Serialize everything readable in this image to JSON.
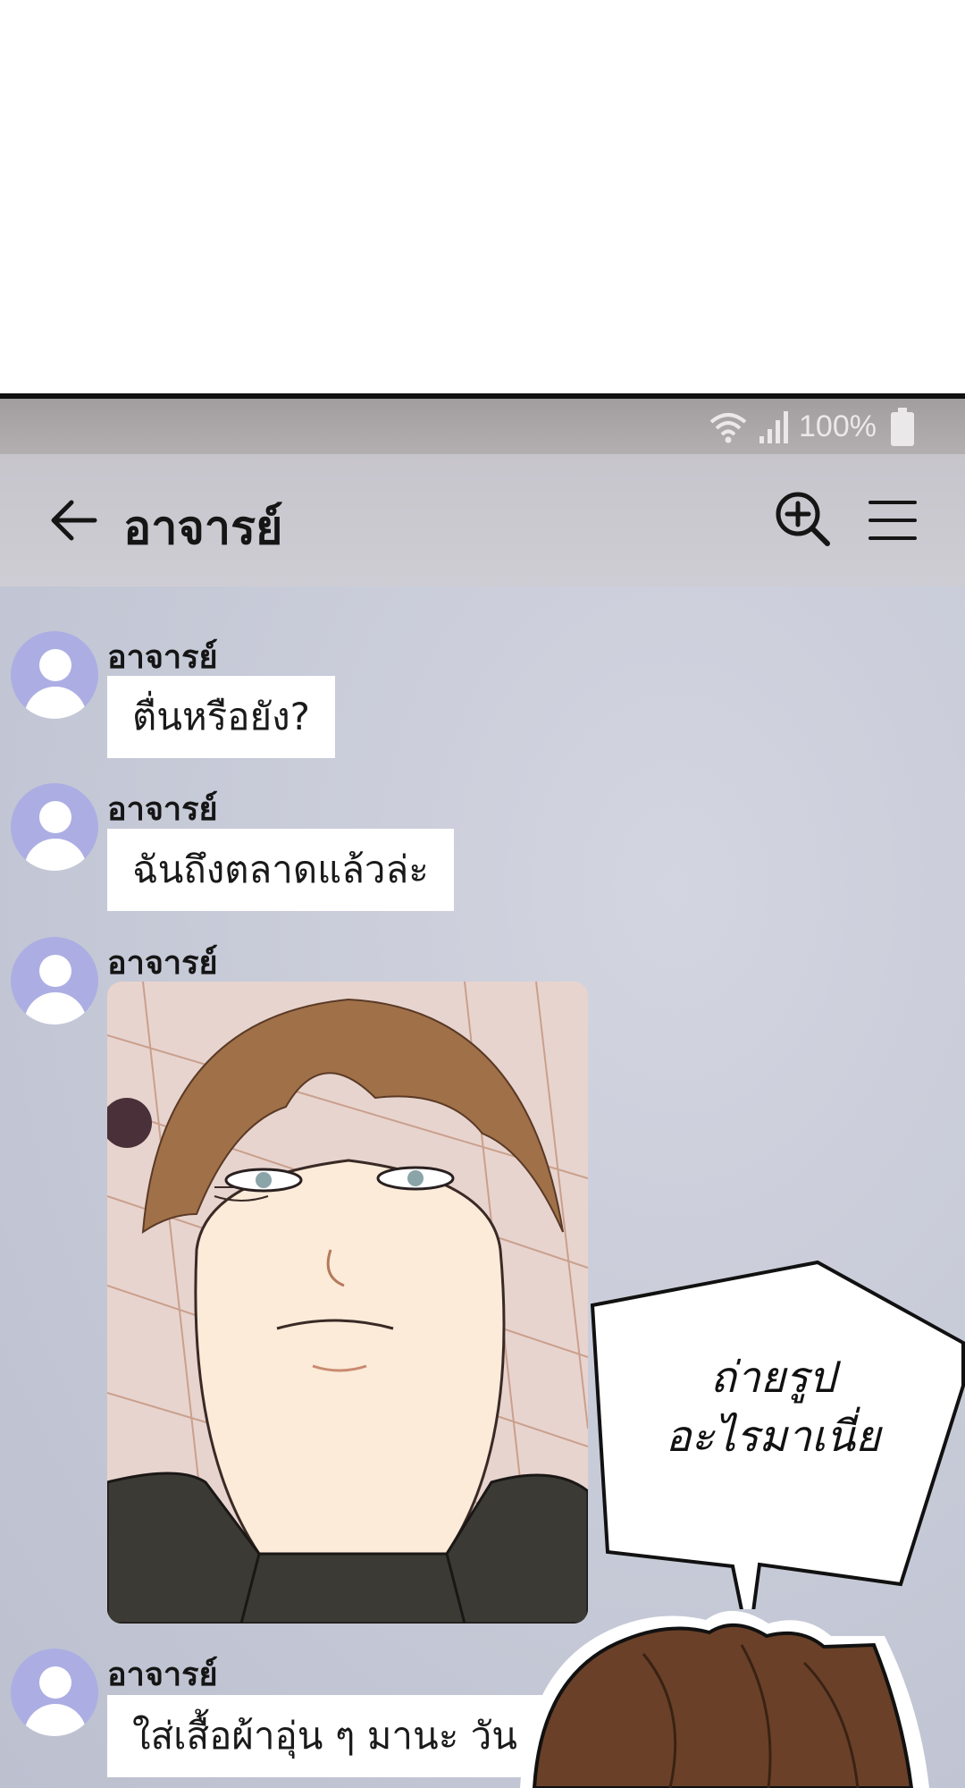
{
  "status_bar": {
    "battery_percent": "100%"
  },
  "header": {
    "title": "อาจารย์"
  },
  "messages": [
    {
      "sender": "อาจารย์",
      "text": "ตื่นหรือยัง?"
    },
    {
      "sender": "อาจารย์",
      "text": "ฉันถึงตลาดแล้วล่ะ"
    },
    {
      "sender": "อาจารย์",
      "type": "photo"
    },
    {
      "sender": "อาจารย์",
      "text": "ใส่เสื้อผ้าอุ่น ๆ มานะ วัน"
    }
  ],
  "speech_bubble": {
    "line1": "ถ่ายรูป",
    "line2": "อะไรมาเนี่ย"
  },
  "colors": {
    "avatar": "#acaee3",
    "chat_bg": "#c8cbd8",
    "header_bg": "#cbc9d0",
    "status_bg": "#aaa6a8"
  }
}
